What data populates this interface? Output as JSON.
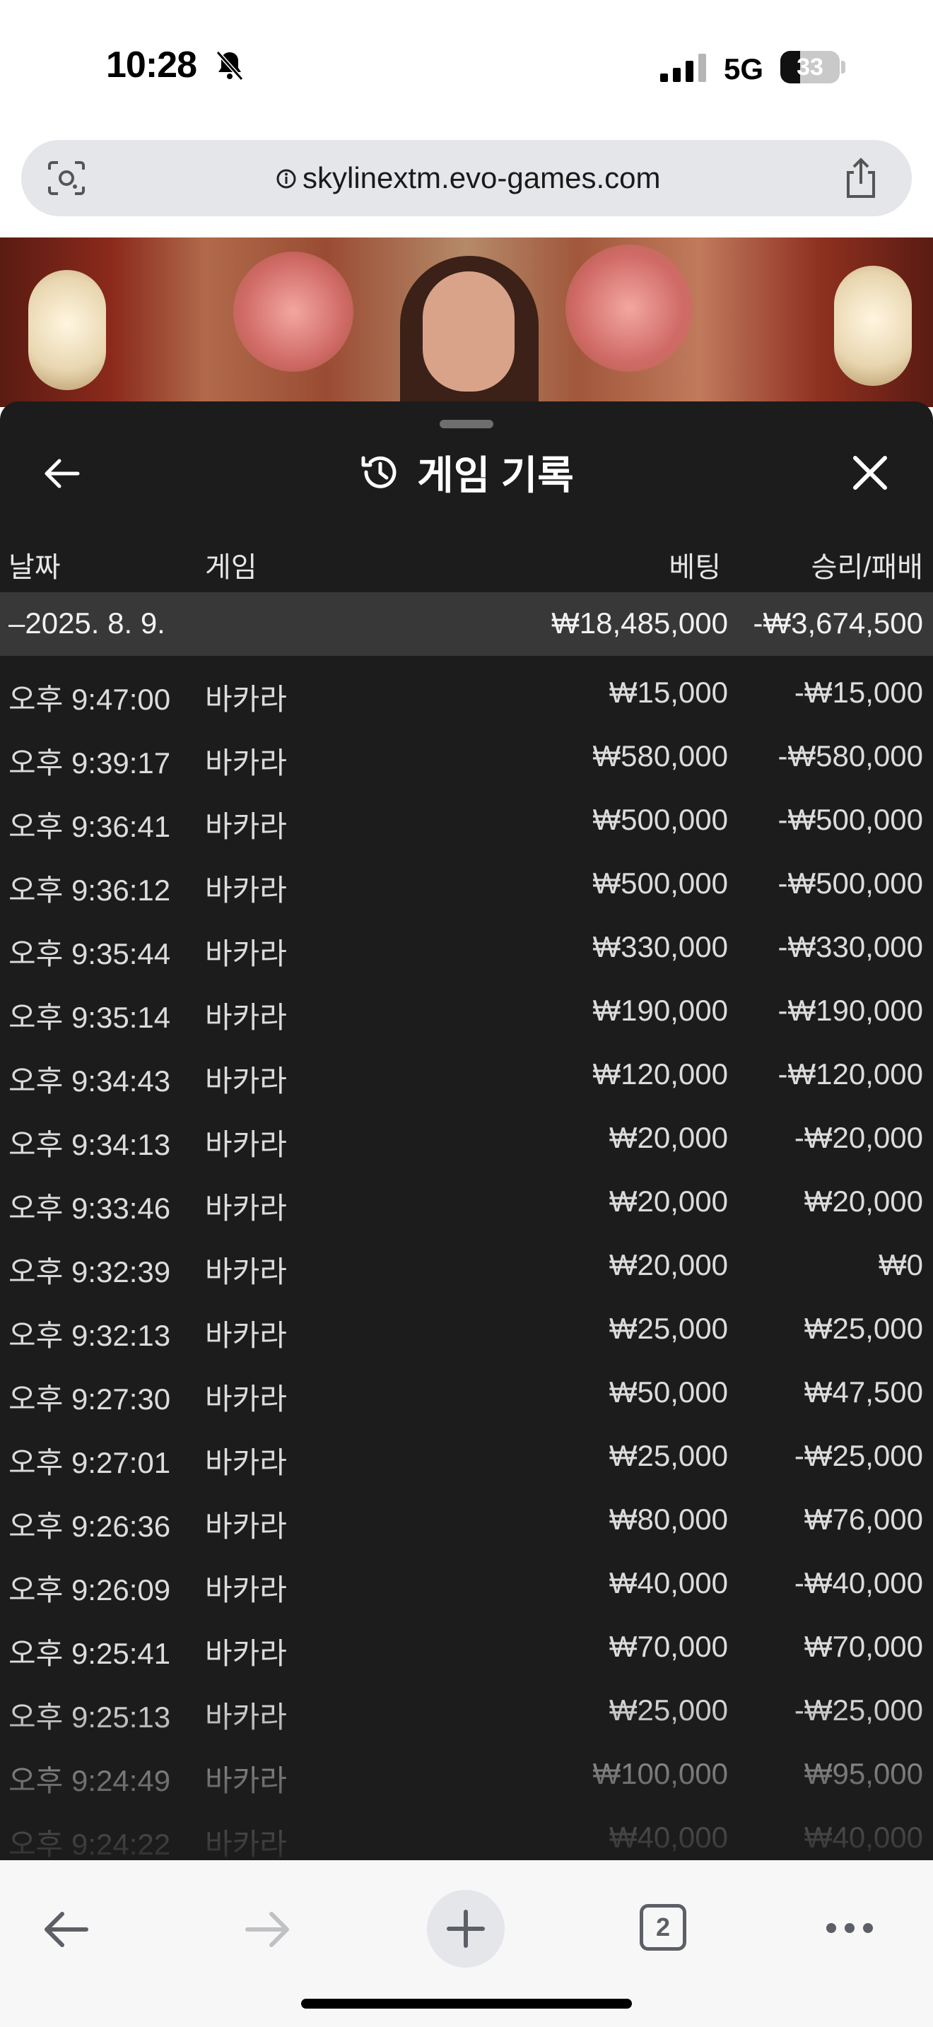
{
  "status_bar": {
    "time": "10:28",
    "network": "5G",
    "battery": 33
  },
  "url_bar": {
    "url": "skylinextm.evo-games.com"
  },
  "panel": {
    "title": "게임 기록"
  },
  "table": {
    "headers": {
      "date": "날짜",
      "game": "게임",
      "bet": "베팅",
      "win_loss": "승리/패배"
    },
    "date_group": {
      "date": "–2025. 8. 9.",
      "bet_total": "₩18,485,000",
      "win_loss_total": "-₩3,674,500"
    },
    "rows": [
      {
        "time": "오후 9:47:00",
        "game": "바카라",
        "bet": "₩15,000",
        "result": "-₩15,000"
      },
      {
        "time": "오후 9:39:17",
        "game": "바카라",
        "bet": "₩580,000",
        "result": "-₩580,000"
      },
      {
        "time": "오후 9:36:41",
        "game": "바카라",
        "bet": "₩500,000",
        "result": "-₩500,000"
      },
      {
        "time": "오후 9:36:12",
        "game": "바카라",
        "bet": "₩500,000",
        "result": "-₩500,000"
      },
      {
        "time": "오후 9:35:44",
        "game": "바카라",
        "bet": "₩330,000",
        "result": "-₩330,000"
      },
      {
        "time": "오후 9:35:14",
        "game": "바카라",
        "bet": "₩190,000",
        "result": "-₩190,000"
      },
      {
        "time": "오후 9:34:43",
        "game": "바카라",
        "bet": "₩120,000",
        "result": "-₩120,000"
      },
      {
        "time": "오후 9:34:13",
        "game": "바카라",
        "bet": "₩20,000",
        "result": "-₩20,000"
      },
      {
        "time": "오후 9:33:46",
        "game": "바카라",
        "bet": "₩20,000",
        "result": "₩20,000"
      },
      {
        "time": "오후 9:32:39",
        "game": "바카라",
        "bet": "₩20,000",
        "result": "₩0"
      },
      {
        "time": "오후 9:32:13",
        "game": "바카라",
        "bet": "₩25,000",
        "result": "₩25,000"
      },
      {
        "time": "오후 9:27:30",
        "game": "바카라",
        "bet": "₩50,000",
        "result": "₩47,500"
      },
      {
        "time": "오후 9:27:01",
        "game": "바카라",
        "bet": "₩25,000",
        "result": "-₩25,000"
      },
      {
        "time": "오후 9:26:36",
        "game": "바카라",
        "bet": "₩80,000",
        "result": "₩76,000"
      },
      {
        "time": "오후 9:26:09",
        "game": "바카라",
        "bet": "₩40,000",
        "result": "-₩40,000"
      },
      {
        "time": "오후 9:25:41",
        "game": "바카라",
        "bet": "₩70,000",
        "result": "₩70,000"
      },
      {
        "time": "오후 9:25:13",
        "game": "바카라",
        "bet": "₩25,000",
        "result": "-₩25,000"
      },
      {
        "time": "오후 9:24:49",
        "game": "바카라",
        "bet": "₩100,000",
        "result": "₩95,000"
      },
      {
        "time": "오후 9:24:22",
        "game": "바카라",
        "bet": "₩40,000",
        "result": "₩40,000"
      }
    ]
  },
  "toolbar": {
    "tab_count": "2"
  }
}
